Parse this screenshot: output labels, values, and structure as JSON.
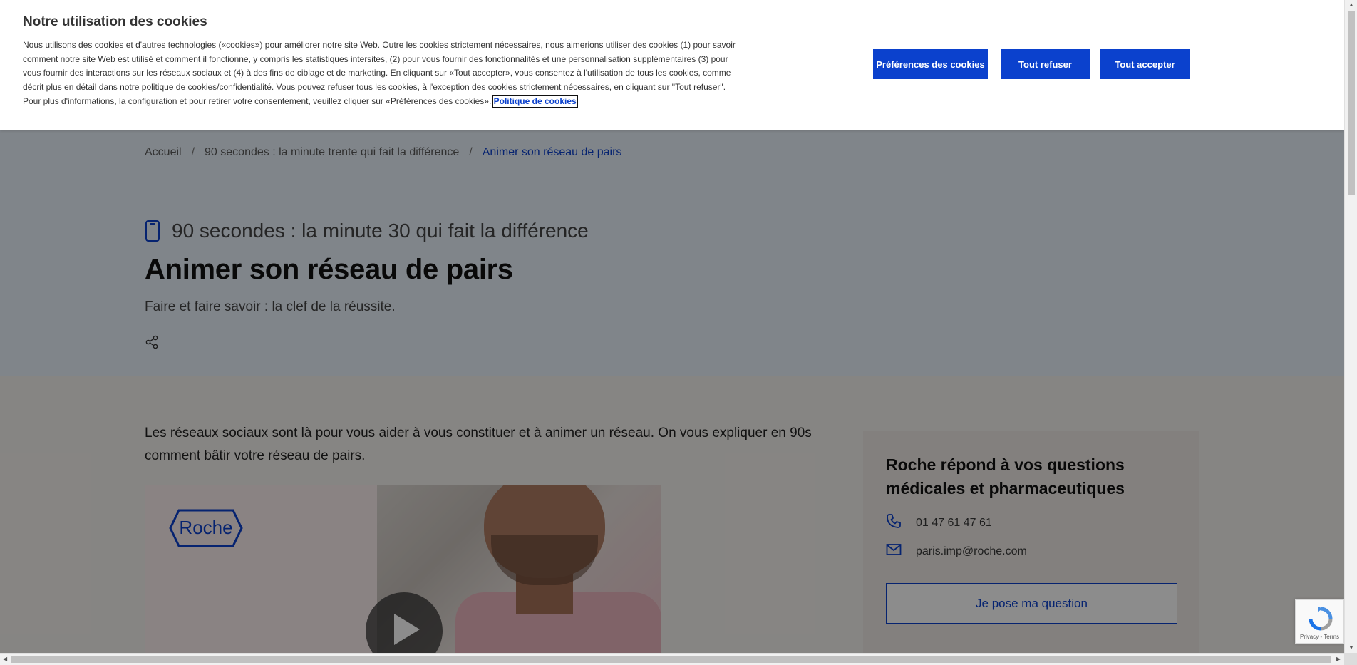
{
  "cookie_banner": {
    "title": "Notre utilisation des cookies",
    "text": "Nous utilisons des cookies et d'autres technologies («cookies») pour améliorer notre site Web. Outre les cookies strictement nécessaires, nous aimerions utiliser des cookies (1) pour savoir comment notre site Web est utilisé et comment il fonctionne, y compris les statistiques intersites, (2) pour vous fournir des fonctionnalités et une personnalisation supplémentaires (3) pour vous fournir des interactions sur les réseaux sociaux et (4) à des fins de ciblage et de marketing. En cliquant sur «Tout accepter», vous consentez à l'utilisation de tous les cookies, comme décrit plus en détail dans notre politique de cookies/confidentialité. Vous pouvez refuser tous les cookies, à l'exception des cookies strictement nécessaires, en cliquant sur \"Tout refuser\". Pour plus d'informations, la configuration et pour retirer votre consentement, veuillez cliquer sur «Préférences des cookies».",
    "policy_link": "Politique de cookies",
    "prefs_button": "Préférences des cookies",
    "refuse_button": "Tout refuser",
    "accept_button": "Tout accepter"
  },
  "breadcrumb": {
    "items": [
      "Accueil",
      "90 secondes : la minute trente qui fait la différence",
      "Animer son réseau de pairs"
    ],
    "separator": "/"
  },
  "hero": {
    "category": "90 secondes : la minute 30 qui fait la différence",
    "category_icon": "smartphone-icon",
    "title": "Animer son réseau de pairs",
    "subtitle": "Faire et faire savoir : la clef de la réussite.",
    "share_icon": "share-icon"
  },
  "main": {
    "intro": "Les réseaux sociaux sont là pour vous aider à vous constituer et à animer un réseau. On vous expliquer en 90s comment bâtir votre réseau de pairs.",
    "video_logo": "Roche"
  },
  "aside": {
    "title": "Roche répond à vos questions médicales et pharmaceutiques",
    "phone": "01 47 61 47 61",
    "email": "paris.imp@roche.com",
    "button": "Je pose ma question"
  },
  "recaptcha": {
    "privacy": "Privacy",
    "terms": "Terms",
    "sep": " - "
  },
  "colors": {
    "brand_blue": "#0b41cd",
    "hero_bg": "#eaf2fb",
    "page_bg": "#f5f2ee"
  }
}
